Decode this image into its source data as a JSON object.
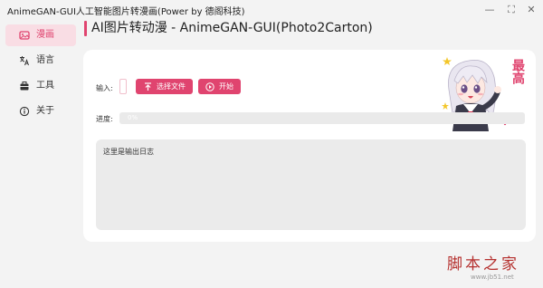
{
  "window": {
    "title": "AnimeGAN-GUI人工智能图片转漫画(Power by 德阁科技)",
    "controls": {
      "minimize": "—",
      "maximize": "⛶",
      "close": "✕"
    }
  },
  "sidebar": {
    "items": [
      {
        "label": "漫画",
        "icon": "image-icon",
        "active": true
      },
      {
        "label": "语言",
        "icon": "translate-icon",
        "active": false
      },
      {
        "label": "工具",
        "icon": "toolbox-icon",
        "active": false
      },
      {
        "label": "关于",
        "icon": "info-icon",
        "active": false
      }
    ]
  },
  "header": {
    "title": "AI图片转动漫 - AnimeGAN-GUI(Photo2Carton)"
  },
  "main": {
    "input_label": "输入:",
    "input_value": "",
    "select_file_label": "选择文件",
    "start_label": "开始",
    "progress_label": "进度:",
    "progress_text": "0%",
    "progress_value": 0,
    "log_text": "这里是输出日志",
    "mascot_caption": "最高"
  },
  "watermark": {
    "text": "脚本之家",
    "url": "www.jb51.net"
  },
  "colors": {
    "accent": "#e0446f",
    "accent_light": "#f9dde4",
    "background": "#f3f3f3",
    "card": "#ffffff",
    "watermark": "#b5302e"
  }
}
